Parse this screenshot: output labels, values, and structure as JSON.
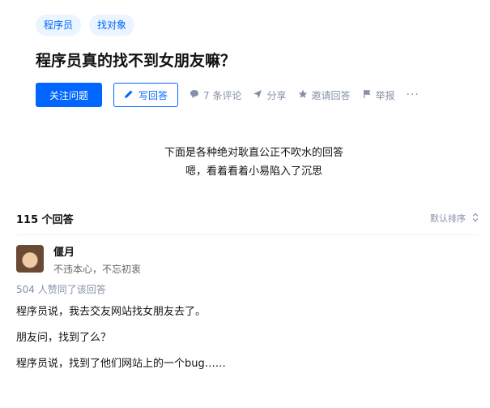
{
  "question": {
    "tags": [
      "程序员",
      "找对象"
    ],
    "title": "程序员真的找不到女朋友嘛？"
  },
  "actions": {
    "follow_label": "关注问题",
    "answer_label": "写回答",
    "comments_label": "7 条评论",
    "share_label": "分享",
    "invite_label": "邀请回答",
    "report_label": "举报",
    "more_label": "···"
  },
  "intro": {
    "line1": "下面是各种绝对耿直公正不吹水的回答",
    "line2": "嗯，看着看着小易陷入了沉思"
  },
  "answers_bar": {
    "count_label": "115 个回答",
    "sort_label": "默认排序"
  },
  "answer": {
    "author_name": "偃月",
    "author_bio": "不违本心，不忘初衷",
    "votes_label": "504 人赞同了该回答",
    "paragraphs": [
      "程序员说，我去交友网站找女朋友去了。",
      "朋友问，找到了么？",
      "程序员说，找到了他们网站上的一个bug……"
    ]
  },
  "colors": {
    "accent": "#0066ff",
    "tag_bg": "#ebf5ff",
    "muted": "#8590a6"
  }
}
